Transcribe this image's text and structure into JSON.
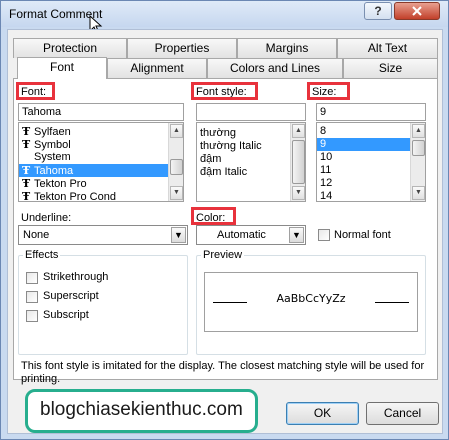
{
  "window": {
    "title": "Format Comment",
    "help_label": "?",
    "close_label": "x"
  },
  "tabs": {
    "row1": [
      "Protection",
      "Properties",
      "Margins",
      "Alt Text"
    ],
    "row2": [
      "Font",
      "Alignment",
      "Colors and Lines",
      "Size"
    ],
    "active": "Font"
  },
  "font": {
    "label": "Font:",
    "value": "Tahoma",
    "items": [
      {
        "icon": "truetype-icon",
        "label": "Sylfaen",
        "selected": false
      },
      {
        "icon": "truetype-icon",
        "label": "Symbol",
        "selected": false
      },
      {
        "icon": "",
        "label": "System",
        "selected": false
      },
      {
        "icon": "truetype-icon",
        "label": "Tahoma",
        "selected": true
      },
      {
        "icon": "truetype-icon",
        "label": "Tekton Pro",
        "selected": false
      },
      {
        "icon": "truetype-icon",
        "label": "Tekton Pro Cond",
        "selected": false
      }
    ]
  },
  "font_style": {
    "label": "Font style:",
    "value": "",
    "items": [
      "thường",
      "thường Italic",
      "đậm",
      "đậm Italic"
    ]
  },
  "size": {
    "label": "Size:",
    "value": "9",
    "items": [
      "8",
      "9",
      "10",
      "11",
      "12",
      "14"
    ],
    "selected": "9"
  },
  "underline": {
    "label": "Underline:",
    "value": "None"
  },
  "color": {
    "label": "Color:",
    "value": "Automatic"
  },
  "normal_font": {
    "label": "Normal font",
    "checked": false
  },
  "effects": {
    "title": "Effects",
    "items": [
      {
        "label": "Strikethrough",
        "checked": false
      },
      {
        "label": "Superscript",
        "checked": false
      },
      {
        "label": "Subscript",
        "checked": false
      }
    ]
  },
  "preview": {
    "title": "Preview",
    "sample": "AaBbCcYyZz"
  },
  "info_text": "This font style is imitated for the display.  The closest matching style will be used for printing.",
  "buttons": {
    "ok": "OK",
    "cancel": "Cancel"
  },
  "watermark": "blogchiasekienthuc.com",
  "colors": {
    "highlight_box": "#e8323c",
    "selection": "#3399ff",
    "watermark_border": "#27ae8e"
  }
}
